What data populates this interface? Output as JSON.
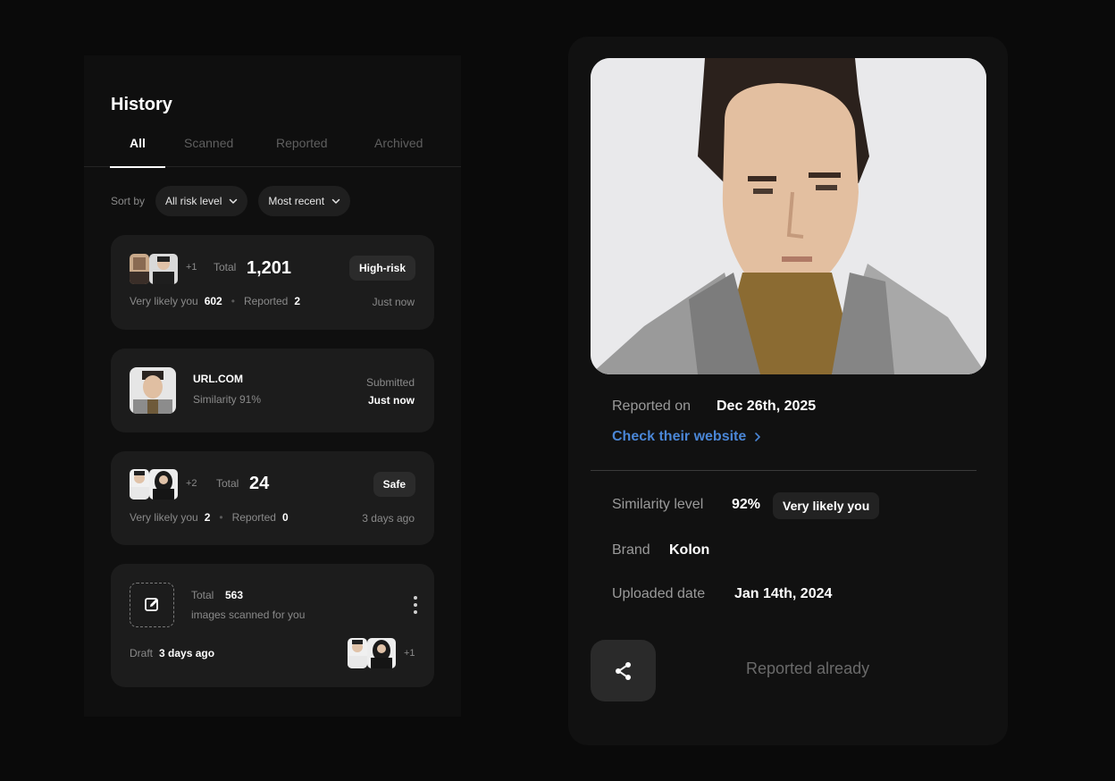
{
  "history": {
    "title": "History",
    "tabs": [
      "All",
      "Scanned",
      "Reported",
      "Archived"
    ],
    "active_tab": "All",
    "sort_label": "Sort by",
    "risk_filter": "All risk level",
    "order_filter": "Most recent"
  },
  "cards": [
    {
      "type": "scan",
      "extra_count": "+1",
      "total_label": "Total",
      "total_value": "1,201",
      "badge": "High-risk",
      "likely_label": "Very likely you",
      "likely_value": "602",
      "reported_label": "Reported",
      "reported_value": "2",
      "time": "Just now"
    },
    {
      "type": "report",
      "site": "URL.COM",
      "similarity": "Similarity 91%",
      "status": "Submitted",
      "time": "Just now"
    },
    {
      "type": "scan",
      "extra_count": "+2",
      "total_label": "Total",
      "total_value": "24",
      "badge": "Safe",
      "likely_label": "Very likely you",
      "likely_value": "2",
      "reported_label": "Reported",
      "reported_value": "0",
      "time": "3 days ago"
    },
    {
      "type": "draft",
      "total_label": "Total",
      "total_value": "563",
      "subtitle": "images scanned for you",
      "draft_label": "Draft",
      "time": "3 days ago",
      "extra_count": "+1"
    }
  ],
  "detail": {
    "reported_on_label": "Reported on",
    "reported_on_value": "Dec 26th, 2025",
    "website_link": "Check their website",
    "similarity_label": "Similarity level",
    "similarity_value": "92%",
    "similarity_badge": "Very likely you",
    "brand_label": "Brand",
    "brand_value": "Kolon",
    "uploaded_label": "Uploaded date",
    "uploaded_value": "Jan 14th, 2024",
    "status_text": "Reported already"
  },
  "icons": {
    "chevron": "chevron-down-icon",
    "edit": "edit-icon",
    "more": "more-vertical-icon",
    "share": "share-icon",
    "link_arrow": "chevron-right-icon"
  },
  "colors": {
    "background": "#0a0a0a",
    "card": "#1c1c1c",
    "link": "#4a86d6"
  }
}
